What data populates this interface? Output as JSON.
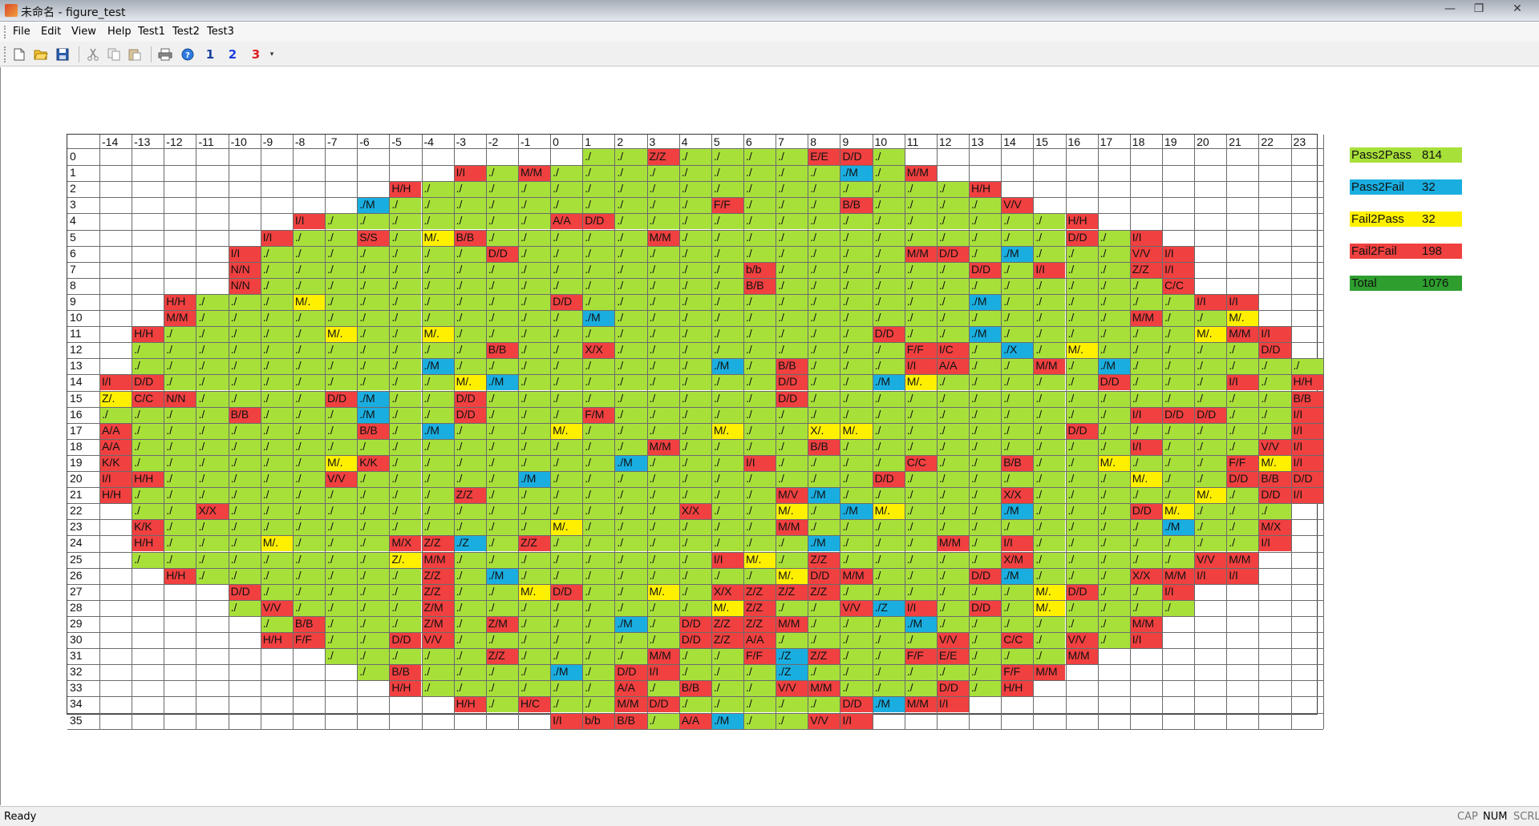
{
  "window": {
    "title": "未命名 - figure_test",
    "minimize": "—",
    "maximize": "❐",
    "close": "✕"
  },
  "menu": [
    "File",
    "Edit",
    "View",
    "Help",
    "Test1",
    "Test2",
    "Test3"
  ],
  "toolbar": [
    "new-icon",
    "open-icon",
    "save-icon",
    "cut-icon",
    "copy-icon",
    "paste-icon",
    "print-icon",
    "about-icon",
    "test1-icon",
    "test2-icon",
    "test3-icon",
    "toolbar-options-icon"
  ],
  "toolbar_glyphs": {
    "test1": "1",
    "test2": "2",
    "test3": "3"
  },
  "colors": {
    "G": "#a8e03a",
    "B": "#1aaee0",
    "Y": "#fff000",
    "R": "#f04040",
    "W": "#ffffff",
    "total": "#2e9e2e"
  },
  "columns": [
    "-14",
    "-13",
    "-12",
    "-11",
    "-10",
    "-9",
    "-8",
    "-7",
    "-6",
    "-5",
    "-4",
    "-3",
    "-2",
    "-1",
    "0",
    "1",
    "2",
    "3",
    "4",
    "5",
    "6",
    "7",
    "8",
    "9",
    "10",
    "11",
    "12",
    "13",
    "14",
    "15",
    "16",
    "17",
    "18",
    "19",
    "20",
    "21",
    "22",
    "23"
  ],
  "rows": [
    "|||||||||||||||./G|./G|Z/ZR|./G|./G|./G|./G|E/ER|D/DR|./G|||||||||||||",
    "|||||||||||I/IR|./G|M/MR|./G|./G|./G|./G|./G|./G|./G|./G|./G|./MB|./G|M/MR|||||||||||",
    "|||||||||H/HR|./G|./G|./G|./G|./G|./G|./G|./G|./G|./G|./G|./G|./G|./G|./G|./G|./G|H/HR|||||||||",
    "||||||||./MB|./G|./G|./G|./G|./G|./G|./G|./G|./G|./G|F/FR|./G|./G|./G|B/BR|./G|./G|./G|./G|V/VR||||||||",
    "||||||I/IR|./G|./G|./G|./G|./G|./G|./G|A/AR|D/DR|./G|./G|./G|./G|./G|./G|./G|./G|./G|./G|./G|./G|./G|./G|H/HR|||||||",
    "|||||I/IR|./G|./G|S/SR|./G|M/.Y|B/BR|./G|./G|./G|./G|./G|M/MR|./G|./G|./G|./G|./G|./G|./G|./G|./G|./G|./G|./G|D/DR|./G|I/IR||||||",
    "||||I/IR|./G|./G|./G|./G|./G|./G|./G|D/DR|./G|./G|./G|./G|./G|./G|./G|./G|./G|./G|./G|./G|M/MR|D/DR|./G|./MB|./G|./G|./G|V/VR|I/IR|||||",
    "||||N/NR|./G|./G|./G|./G|./G|./G|./G|./G|./G|./G|./G|./G|./G|./G|./G|b/bR|./G|./G|./G|./G|./G|./G|D/DR|./G|I/IR|./G|./G|Z/ZR|I/IR|||||",
    "||||N/NR|./G|./G|./G|./G|./G|./G|./G|./G|./G|./G|./G|./G|./G|./G|./G|B/BR|./G|./G|./G|./G|./G|./G|./G|./G|./G|./G|./G|./G|C/CR|||||",
    "||H/HR|./G|./G|./G|M/.Y|./G|./G|./G|./G|./G|./G|./G|D/DR|./G|./G|./G|./G|./G|./G|./G|./G|./G|./G|./G|./G|./MB|./G|./G|./G|./G|./G|./G|I/IR|I/IR||",
    "||M/MR|./G|./G|./G|./G|./G|./G|./G|./G|./G|./G|./G|./G|./MB|./G|./G|./G|./G|./G|./G|./G|./G|./G|./G|./G|./G|./G|./G|./G|./G|M/MR|./G|./G|M/.Y||",
    "|H/HR|./G|./G|./G|./G|./G|M/.Y|./G|./G|M/.Y|./G|./G|./G|./G|./G|./G|./G|./G|./G|./G|./G|./G|./G|D/DR|./G|./G|./MB|./G|./G|./G|./G|./G|./G|M/.Y|M/MR|I/IR|",
    "|./G|./G|./G|./G|./G|./G|./G|./G|./G|./G|./G|B/BR|./G|./G|X/XR|./G|./G|./G|./G|./G|./G|./G|./G|./G|F/FR|I/CR|./G|./XB|./G|M/.Y|./G|./G|./G|./G|./G|D/DR|",
    "|./G|./G|./G|./G|./G|./G|./G|./G|./G|./MB|./G|./G|./G|./G|./G|./G|./G|./G|./MB|./G|B/BR|./G|./G|./G|I/IR|A/AR|./G|./G|M/MR|./G|./MB|./G|./G|./G|./G|./G|./G|",
    "I/IR|D/DR|./G|./G|./G|./G|./G|./G|./G|./G|./G|M/.Y|./MB|./G|./G|./G|./G|./G|./G|./G|./G|D/DR|./G|./G|./MB|M/.Y|./G|./G|./G|./G|./G|D/DR|./G|./G|./G|I/IR|./G|H/HR",
    "Z/.Y|C/CR|N/NR|./G|./G|./G|./G|D/DR|./MB|./G|./G|D/DR|./G|./G|./G|./G|./G|./G|./G|./G|./G|D/DR|./G|./G|./G|./G|./G|./G|./G|./G|./G|./G|./G|./G|./G|./G|./G|B/BR",
    "./G|./G|./G|./G|B/BR|./G|./G|./G|./MB|./G|./G|D/DR|./G|./G|./G|F/MR|./G|./G|./G|./G|./G|./G|./G|./G|./G|./G|./G|./G|./G|./G|./G|./G|I/IR|D/DR|D/DR|./G|./G|I/IR",
    "A/AR|./G|./G|./G|./G|./G|./G|./G|B/BR|./G|./MB|./G|./G|./G|M/.Y|./G|./G|./G|./G|M/.Y|./G|./G|X/.Y|M/.Y|./G|./G|./G|./G|./G|./G|D/DR|./G|./G|./G|./G|./G|./G|I/IR",
    "A/AR|./G|./G|./G|./G|./G|./G|./G|./G|./G|./G|./G|./G|./G|./G|./G|./G|M/MR|./G|./G|./G|./G|B/BR|./G|./G|./G|./G|./G|./G|./G|./G|./G|I/IR|./G|./G|./G|V/VR|I/IR",
    "K/KR|./G|./G|./G|./G|./G|./G|M/.Y|K/KR|./G|./G|./G|./G|./G|./G|./G|./MB|./G|./G|./G|I/IR|./G|./G|./G|./G|C/CR|./G|./G|B/BR|./G|./G|M/.Y|./G|./G|./G|F/FR|M/.Y|I/IR",
    "I/IR|H/HR|./G|./G|./G|./G|./G|V/VR|./G|./G|./G|./G|./G|./MB|./G|./G|./G|./G|./G|./G|./G|./G|./G|./G|D/DR|./G|./G|./G|./G|./G|./G|./G|M/.Y|./G|./G|D/DR|B/BR|D/DR",
    "H/HR|./G|./G|./G|./G|./G|./G|./G|./G|./G|./G|Z/ZR|./G|./G|./G|./G|./G|./G|./G|./G|./G|M/VR|./MB|./G|./G|./G|./G|./G|X/XR|./G|./G|./G|./G|./G|M/.Y|./G|D/DR|I/IR",
    "|./G|./G|X/XR|./G|./G|./G|./G|./G|./G|./G|./G|./G|./G|./G|./G|./G|./G|X/XR|./G|./G|M/.Y|./G|./MB|M/.Y|./G|./G|./G|./MB|./G|./G|./G|D/DR|M/.Y|./G|./G|./G|",
    "|K/KR|./G|./G|./G|./G|./G|./G|./G|./G|./G|./G|./G|./G|M/.Y|./G|./G|./G|./G|./G|./G|M/MR|./G|./G|./G|./G|./G|./G|./G|./G|./G|./G|./G|./MB|./G|./G|M/XR|",
    "|H/HR|./G|./G|./G|M/.Y|./G|./G|./G|M/XR|Z/ZR|./ZB|./G|Z/ZR|./G|./G|./G|./G|./G|./G|./G|./G|./MB|./G|./G|./G|M/MR|./G|I/IR|./G|./G|./G|./G|./G|./G|./G|I/IR|",
    "|./G|./G|./G|./G|./G|./G|./G|./G|Z/.Y|M/MR|./G|./G|./G|./G|./G|./G|./G|./G|I/IR|M/.Y|./G|Z/ZR|./G|./G|./G|./G|./G|X/MR|./G|./G|./G|./G|./G|V/VR|M/MR||",
    "||H/HR|./G|./G|./G|./G|./G|./G|./G|Z/ZR|./G|./MB|./G|./G|./G|./G|./G|./G|./G|./G|M/.Y|D/DR|M/MR|./G|./G|./G|D/DR|./MB|./G|./G|./G|X/XR|M/MR|I/IR|I/IR||",
    "||||D/DR|./G|./G|./G|./G|./G|Z/ZR|./G|./G|M/.Y|D/DR|./G|./G|M/.Y|./G|X/XR|Z/ZR|Z/ZR|Z/ZR|./G|./G|./G|./G|./G|./G|M/.Y|D/DR|./G|./G|I/IR||||",
    "||||./G|V/VR|./G|./G|./G|./G|Z/MR|./G|./G|./G|./G|./G|./G|./G|./G|M/.Y|Z/ZR|./G|./G|V/VR|./ZB|I/IR|./G|D/DR|./G|M/.Y|./G|./G|./G|./G||||",
    "|||||./G|B/BR|./G|./G|./G|Z/MR|./G|Z/MR|./G|./G|./G|./MB|./G|D/DR|Z/ZR|Z/ZR|M/MR|./G|./G|./G|./MB|./G|./G|./G|./G|./G|./G|M/MR|||||",
    "|||||H/HR|F/FR|./G|./G|D/DR|V/VR|./G|./G|./G|./G|./G|./G|./G|D/DR|Z/ZR|A/AR|./G|./G|./G|./G|./G|V/VR|./G|C/CR|./G|V/VR|./G|I/IR|||||",
    "|||||||./G|./G|./G|./G|./G|Z/ZR|./G|./G|./G|./G|M/MR|./G|./G|F/FR|./ZB|Z/ZR|./G|./G|F/FR|E/ER|./G|./G|./G|M/MR|||||||",
    "||||||||./G|B/BR|./G|./G|./G|./G|./MB|./G|D/DR|I/IR|./G|./G|./G|./ZB|./G|./G|./G|./G|./G|./G|F/FR|M/MR||||||||",
    "|||||||||H/HR|./G|./G|./G|./G|./G|./G|A/AR|./G|B/BR|./G|./G|V/VR|M/MR|./G|./G|./G|D/DR|./G|H/HR|||||||||",
    "|||||||||||H/HR|./G|H/CR|./G|./G|M/MR|D/DR|./G|./G|./G|./G|./G|D/DR|./MB|M/MR|I/IR|||||||||||",
    "||||||||||||||I/IR|b/bR|B/BR|./G|A/AR|./MB|./G|./G|V/VR|I/IR||||||||||||||"
  ],
  "legend": [
    {
      "label": "Pass2Pass",
      "value": "814",
      "color": "#a8e03a"
    },
    {
      "label": "Pass2Fail",
      "value": "32",
      "color": "#1aaee0"
    },
    {
      "label": "Fail2Pass",
      "value": "32",
      "color": "#fff000"
    },
    {
      "label": "Fail2Fail",
      "value": "198",
      "color": "#f04040"
    },
    {
      "label": "Total",
      "value": "1076",
      "color": "#2e9e2e"
    }
  ],
  "status": {
    "text": "Ready",
    "cap": "CAP",
    "num": "NUM",
    "scrl": "SCRL"
  }
}
